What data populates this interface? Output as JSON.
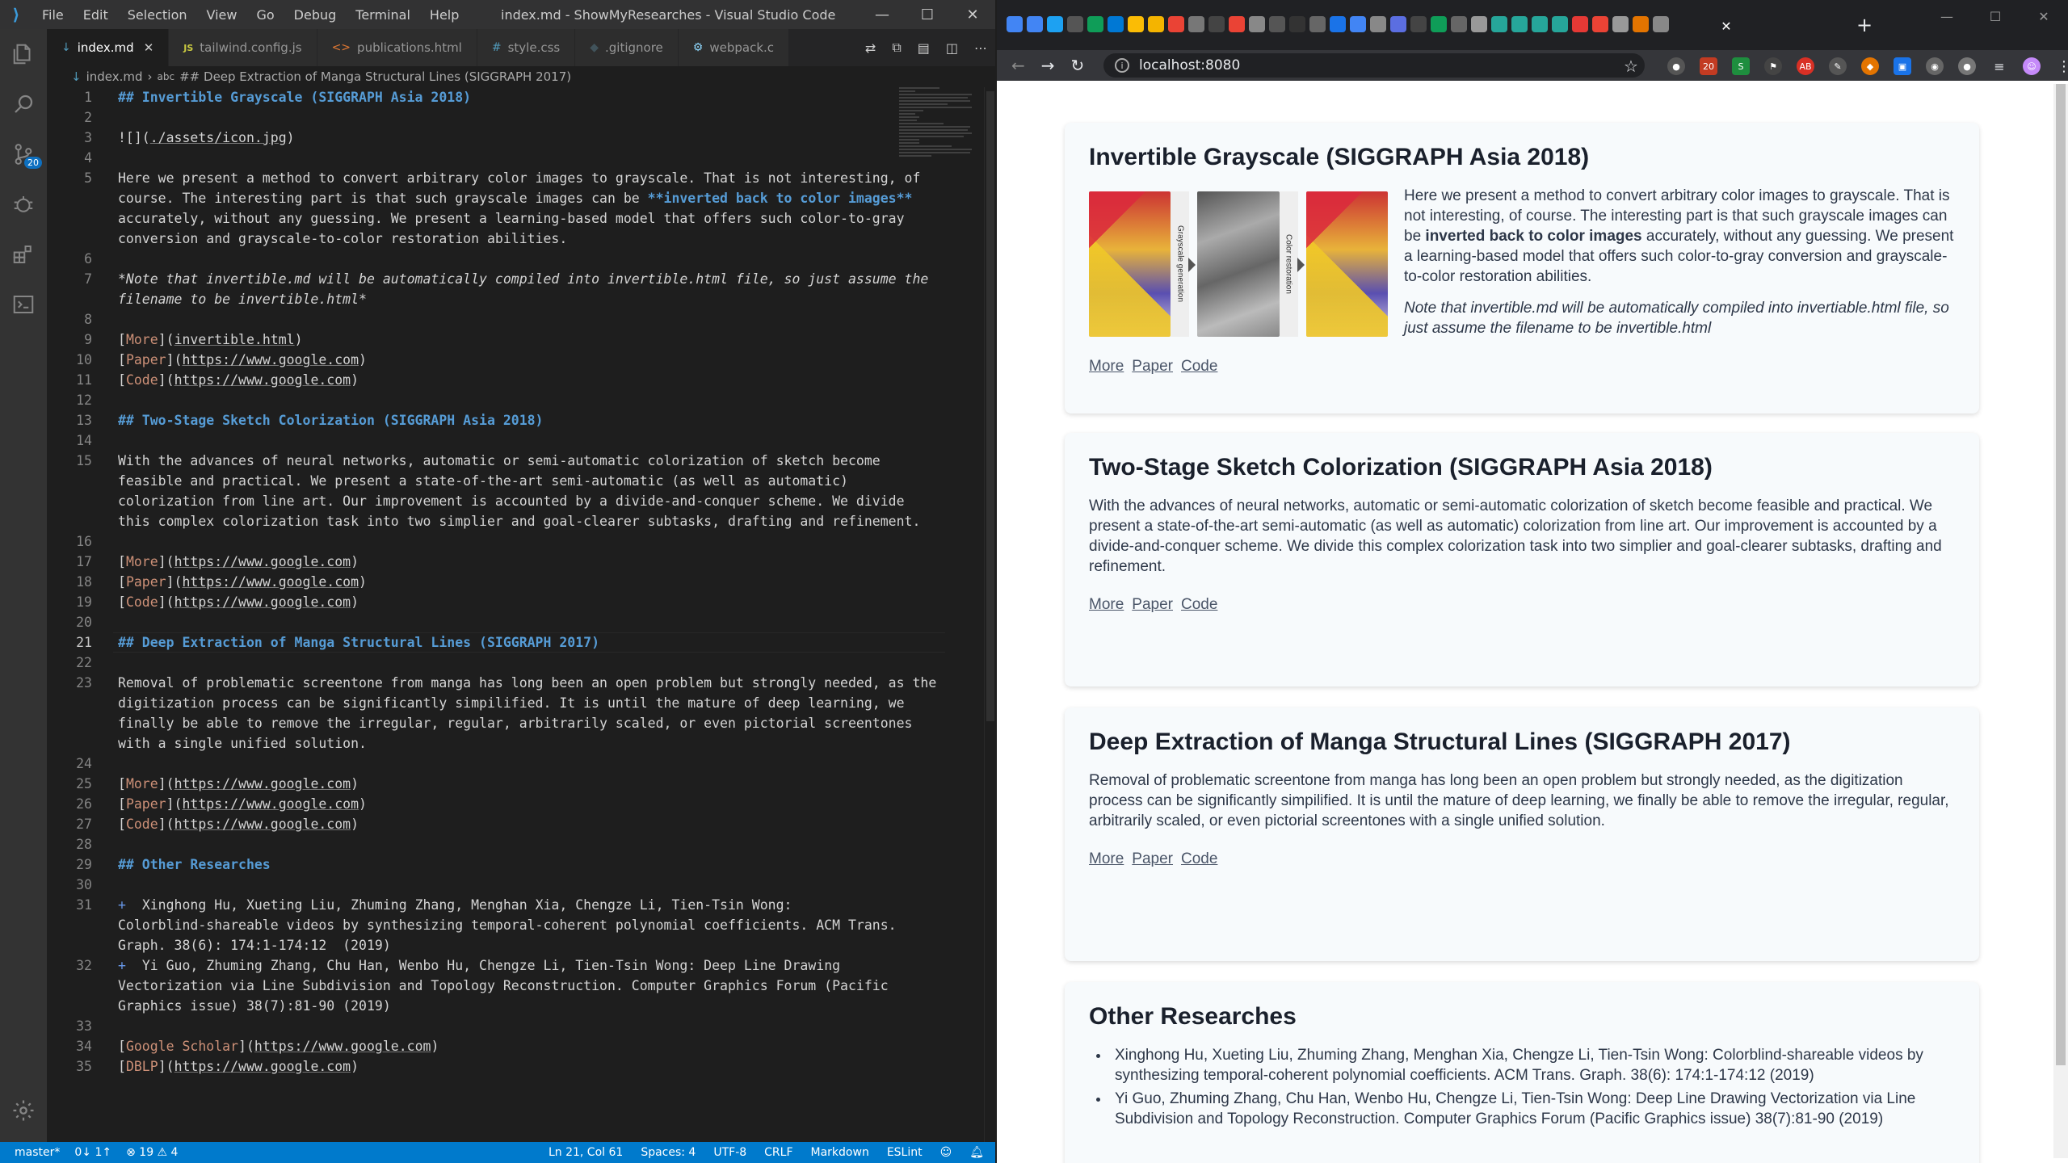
{
  "vscode": {
    "menu": [
      "File",
      "Edit",
      "Selection",
      "View",
      "Go",
      "Debug",
      "Terminal",
      "Help"
    ],
    "window_title": "index.md - ShowMyResearches - Visual Studio Code",
    "scm_badge": "20",
    "tabs": [
      {
        "icon": "↓",
        "label": "index.md",
        "active": true
      },
      {
        "icon": "JS",
        "label": "tailwind.config.js"
      },
      {
        "icon": "<>",
        "label": "publications.html"
      },
      {
        "icon": "#",
        "label": "style.css"
      },
      {
        "icon": "◆",
        "label": ".gitignore"
      },
      {
        "icon": "⚙",
        "label": "webpack.c"
      }
    ],
    "breadcrumb": {
      "file": "index.md",
      "symbol": "## Deep Extraction of Manga Structural Lines (SIGGRAPH 2017)"
    },
    "lines": [
      {
        "n": "1",
        "segs": [
          {
            "t": "## Invertible Grayscale (SIGGRAPH Asia 2018)",
            "c": "h"
          }
        ]
      },
      {
        "n": "2",
        "segs": []
      },
      {
        "n": "3",
        "segs": [
          {
            "t": "![](",
            "c": ""
          },
          {
            "t": "./assets/icon.jpg",
            "c": "lnk"
          },
          {
            "t": ")",
            "c": ""
          }
        ]
      },
      {
        "n": "4",
        "segs": []
      },
      {
        "n": "5",
        "segs": [
          {
            "t": "Here we present a method to convert arbitrary color images to grayscale. That is not interesting, of",
            "c": ""
          }
        ]
      },
      {
        "n": "",
        "segs": [
          {
            "t": "course. The interesting part is that such grayscale images can be ",
            "c": ""
          },
          {
            "t": "**inverted back to color images**",
            "c": "b"
          }
        ]
      },
      {
        "n": "",
        "segs": [
          {
            "t": "accurately, without any guessing. We present a learning-based model that offers such color-to-gray",
            "c": ""
          }
        ]
      },
      {
        "n": "",
        "segs": [
          {
            "t": "conversion and grayscale-to-color restoration abilities.",
            "c": ""
          }
        ]
      },
      {
        "n": "6",
        "segs": []
      },
      {
        "n": "7",
        "segs": [
          {
            "t": "*Note that invertible.md will be automatically compiled into invertible.html file, so just assume the",
            "c": "em"
          }
        ]
      },
      {
        "n": "",
        "segs": [
          {
            "t": "filename to be invertible.html*",
            "c": "em"
          }
        ]
      },
      {
        "n": "8",
        "segs": []
      },
      {
        "n": "9",
        "segs": [
          {
            "t": "[",
            "c": ""
          },
          {
            "t": "More",
            "c": "br"
          },
          {
            "t": "](",
            "c": ""
          },
          {
            "t": "invertible.html",
            "c": "lnk"
          },
          {
            "t": ")",
            "c": ""
          }
        ]
      },
      {
        "n": "10",
        "segs": [
          {
            "t": "[",
            "c": ""
          },
          {
            "t": "Paper",
            "c": "br"
          },
          {
            "t": "](",
            "c": ""
          },
          {
            "t": "https://www.google.com",
            "c": "lnk"
          },
          {
            "t": ")",
            "c": ""
          }
        ]
      },
      {
        "n": "11",
        "segs": [
          {
            "t": "[",
            "c": ""
          },
          {
            "t": "Code",
            "c": "br"
          },
          {
            "t": "](",
            "c": ""
          },
          {
            "t": "https://www.google.com",
            "c": "lnk"
          },
          {
            "t": ")",
            "c": ""
          }
        ]
      },
      {
        "n": "12",
        "segs": []
      },
      {
        "n": "13",
        "segs": [
          {
            "t": "## Two-Stage Sketch Colorization (SIGGRAPH Asia 2018)",
            "c": "h"
          }
        ]
      },
      {
        "n": "14",
        "segs": []
      },
      {
        "n": "15",
        "segs": [
          {
            "t": "With the advances of neural networks, automatic or semi-automatic colorization of sketch become",
            "c": ""
          }
        ]
      },
      {
        "n": "",
        "segs": [
          {
            "t": "feasible and practical. We present a state-of-the-art semi-automatic (as well as automatic)",
            "c": ""
          }
        ]
      },
      {
        "n": "",
        "segs": [
          {
            "t": "colorization from line art. Our improvement is accounted by a divide-and-conquer scheme. We divide",
            "c": ""
          }
        ]
      },
      {
        "n": "",
        "segs": [
          {
            "t": "this complex colorization task into two simplier and goal-clearer subtasks, drafting and refinement.",
            "c": ""
          }
        ]
      },
      {
        "n": "16",
        "segs": []
      },
      {
        "n": "17",
        "segs": [
          {
            "t": "[",
            "c": ""
          },
          {
            "t": "More",
            "c": "br"
          },
          {
            "t": "](",
            "c": ""
          },
          {
            "t": "https://www.google.com",
            "c": "lnk"
          },
          {
            "t": ")",
            "c": ""
          }
        ]
      },
      {
        "n": "18",
        "segs": [
          {
            "t": "[",
            "c": ""
          },
          {
            "t": "Paper",
            "c": "br"
          },
          {
            "t": "](",
            "c": ""
          },
          {
            "t": "https://www.google.com",
            "c": "lnk"
          },
          {
            "t": ")",
            "c": ""
          }
        ]
      },
      {
        "n": "19",
        "segs": [
          {
            "t": "[",
            "c": ""
          },
          {
            "t": "Code",
            "c": "br"
          },
          {
            "t": "](",
            "c": ""
          },
          {
            "t": "https://www.google.com",
            "c": "lnk"
          },
          {
            "t": ")",
            "c": ""
          }
        ]
      },
      {
        "n": "20",
        "segs": []
      },
      {
        "n": "21",
        "segs": [
          {
            "t": "## Deep Extraction of Manga Structural Lines (SIGGRAPH 2017)",
            "c": "h"
          }
        ],
        "cursor": true
      },
      {
        "n": "22",
        "segs": []
      },
      {
        "n": "23",
        "segs": [
          {
            "t": "Removal of problematic screentone from manga has long been an open problem but strongly needed, as the",
            "c": ""
          }
        ]
      },
      {
        "n": "",
        "segs": [
          {
            "t": "digitization process can be significantly simpilified. It is until the mature of deep learning, we",
            "c": ""
          }
        ]
      },
      {
        "n": "",
        "segs": [
          {
            "t": "finally be able to remove the irregular, regular, arbitrarily scaled, or even pictorial screentones",
            "c": ""
          }
        ]
      },
      {
        "n": "",
        "segs": [
          {
            "t": "with a single unified solution.",
            "c": ""
          }
        ]
      },
      {
        "n": "24",
        "segs": []
      },
      {
        "n": "25",
        "segs": [
          {
            "t": "[",
            "c": ""
          },
          {
            "t": "More",
            "c": "br"
          },
          {
            "t": "](",
            "c": ""
          },
          {
            "t": "https://www.google.com",
            "c": "lnk"
          },
          {
            "t": ")",
            "c": ""
          }
        ]
      },
      {
        "n": "26",
        "segs": [
          {
            "t": "[",
            "c": ""
          },
          {
            "t": "Paper",
            "c": "br"
          },
          {
            "t": "](",
            "c": ""
          },
          {
            "t": "https://www.google.com",
            "c": "lnk"
          },
          {
            "t": ")",
            "c": ""
          }
        ]
      },
      {
        "n": "27",
        "segs": [
          {
            "t": "[",
            "c": ""
          },
          {
            "t": "Code",
            "c": "br"
          },
          {
            "t": "](",
            "c": ""
          },
          {
            "t": "https://www.google.com",
            "c": "lnk"
          },
          {
            "t": ")",
            "c": ""
          }
        ]
      },
      {
        "n": "28",
        "segs": []
      },
      {
        "n": "29",
        "segs": [
          {
            "t": "## Other Researches",
            "c": "h"
          }
        ]
      },
      {
        "n": "30",
        "segs": []
      },
      {
        "n": "31",
        "segs": [
          {
            "t": "+  ",
            "c": "bul"
          },
          {
            "t": "Xinghong Hu, Xueting Liu, Zhuming Zhang, Menghan Xia, Chengze Li, Tien-Tsin Wong:",
            "c": ""
          }
        ]
      },
      {
        "n": "",
        "segs": [
          {
            "t": "Colorblind-shareable videos by synthesizing temporal-coherent polynomial coefficients. ACM Trans.",
            "c": ""
          }
        ]
      },
      {
        "n": "",
        "segs": [
          {
            "t": "Graph. 38(6): 174:1-174:12  (2019)",
            "c": ""
          }
        ]
      },
      {
        "n": "32",
        "segs": [
          {
            "t": "+  ",
            "c": "bul"
          },
          {
            "t": "Yi Guo, Zhuming Zhang, Chu Han, Wenbo Hu, Chengze Li, Tien-Tsin Wong: Deep Line Drawing",
            "c": ""
          }
        ]
      },
      {
        "n": "",
        "segs": [
          {
            "t": "Vectorization via Line Subdivision and Topology Reconstruction. Computer Graphics Forum (Pacific",
            "c": ""
          }
        ]
      },
      {
        "n": "",
        "segs": [
          {
            "t": "Graphics issue) 38(7):81-90 (2019)",
            "c": ""
          }
        ]
      },
      {
        "n": "33",
        "segs": []
      },
      {
        "n": "34",
        "segs": [
          {
            "t": "[",
            "c": ""
          },
          {
            "t": "Google Scholar",
            "c": "br"
          },
          {
            "t": "](",
            "c": ""
          },
          {
            "t": "https://www.google.com",
            "c": "lnk"
          },
          {
            "t": ")",
            "c": ""
          }
        ]
      },
      {
        "n": "35",
        "segs": [
          {
            "t": "[",
            "c": ""
          },
          {
            "t": "DBLP",
            "c": "br"
          },
          {
            "t": "](",
            "c": ""
          },
          {
            "t": "https://www.google.com",
            "c": "lnk"
          },
          {
            "t": ")",
            "c": ""
          }
        ]
      }
    ],
    "status": {
      "branch": "master*",
      "sync": "0↓ 1↑",
      "problems": "⊗ 19 ⚠ 4",
      "position": "Ln 21, Col 61",
      "spaces": "Spaces: 4",
      "encoding": "UTF-8",
      "eol": "CRLF",
      "language": "Markdown",
      "linter": "ESLint"
    }
  },
  "chrome": {
    "address": "localhost:8080",
    "ext_badge": "20",
    "page": {
      "sections": [
        {
          "title": "Invertible Grayscale (SIGGRAPH Asia 2018)",
          "para_pre": "Here we present a method to convert arbitrary color images to grayscale. That is not interesting, of course. The interesting part is that such grayscale images can be ",
          "para_bold": "inverted back to color images",
          "para_post": " accurately, without any guessing. We present a learning-based model that offers such color-to-gray conversion and grayscale-to-color restoration abilities.",
          "note": "Note that invertible.md will be automatically compiled into invertiable.html file, so just assume the filename to be invertible.html",
          "teaser_labels": [
            "Grayscale generation",
            "Color restoration"
          ],
          "links": [
            "More",
            "Paper",
            "Code"
          ]
        },
        {
          "title": "Two-Stage Sketch Colorization (SIGGRAPH Asia 2018)",
          "para": "With the advances of neural networks, automatic or semi-automatic colorization of sketch become feasible and practical. We present a state-of-the-art semi-automatic (as well as automatic) colorization from line art. Our improvement is accounted by a divide-and-conquer scheme. We divide this complex colorization task into two simplier and goal-clearer subtasks, drafting and refinement.",
          "links": [
            "More",
            "Paper",
            "Code"
          ]
        },
        {
          "title": "Deep Extraction of Manga Structural Lines (SIGGRAPH 2017)",
          "para": "Removal of problematic screentone from manga has long been an open problem but strongly needed, as the digitization process can be significantly simpilified. It is until the mature of deep learning, we finally be able to remove the irregular, regular, arbitrarily scaled, or even pictorial screentones with a single unified solution.",
          "links": [
            "More",
            "Paper",
            "Code"
          ]
        },
        {
          "title": "Other Researches",
          "items": [
            "Xinghong Hu, Xueting Liu, Zhuming Zhang, Menghan Xia, Chengze Li, Tien-Tsin Wong: Colorblind-shareable videos by synthesizing temporal-coherent polynomial coefficients. ACM Trans. Graph. 38(6): 174:1-174:12 (2019)",
            "Yi Guo, Zhuming Zhang, Chu Han, Wenbo Hu, Chengze Li, Tien-Tsin Wong: Deep Line Drawing Vectorization via Line Subdivision and Topology Reconstruction. Computer Graphics Forum (Pacific Graphics issue) 38(7):81-90 (2019)"
          ]
        }
      ]
    }
  }
}
